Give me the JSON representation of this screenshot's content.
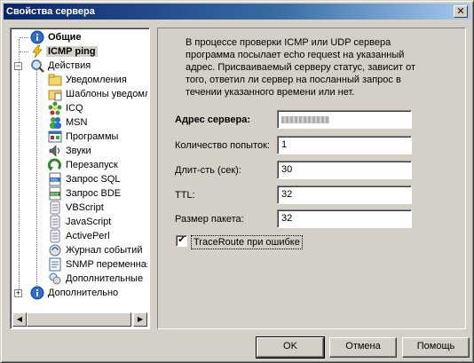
{
  "window": {
    "title": "Свойства сервера",
    "close": "✕"
  },
  "tree": {
    "items": [
      {
        "label": "Общие",
        "icon": "info-icon"
      },
      {
        "label": "ICMP ping",
        "icon": "lightning-icon"
      },
      {
        "label": "Действия",
        "icon": "search-icon"
      },
      {
        "label": "Уведомления",
        "icon": "folder-icon"
      },
      {
        "label": "Шаблоны уведомл",
        "icon": "folder-template-icon"
      },
      {
        "label": "ICQ",
        "icon": "icq-flower-icon"
      },
      {
        "label": "MSN",
        "icon": "msn-people-icon"
      },
      {
        "label": "Программы",
        "icon": "programs-icon"
      },
      {
        "label": "Звуки",
        "icon": "speaker-icon"
      },
      {
        "label": "Перезапуск",
        "icon": "restart-arrow-icon"
      },
      {
        "label": "Запрос SQL",
        "icon": "sql-doc-icon"
      },
      {
        "label": "Запрос BDE",
        "icon": "bde-doc-icon"
      },
      {
        "label": "VBScript",
        "icon": "script-scroll-icon"
      },
      {
        "label": "JavaScript",
        "icon": "script-scroll-icon"
      },
      {
        "label": "ActivePerl",
        "icon": "script-scroll-icon"
      },
      {
        "label": "Журнал событий",
        "icon": "journal-icon"
      },
      {
        "label": "SNMP переменная",
        "icon": "snmp-doc-icon"
      },
      {
        "label": "Дополнительные",
        "icon": "additional-icon"
      },
      {
        "label": "Дополнительно",
        "icon": "info-icon"
      }
    ]
  },
  "panel": {
    "description": "В процессе проверки ICMP или UDP сервера программа посылает echo request на указанный адрес. Присваиваемый серверу статус, зависит от того, ответил ли сервер на посланный запрос в течении указанного времени или нет.",
    "fields": [
      {
        "label": "Адрес сервера:",
        "value": ""
      },
      {
        "label": "Количество попыток:",
        "value": "1"
      },
      {
        "label": "Длит-сть (сек):",
        "value": "30"
      },
      {
        "label": "TTL:",
        "value": "32"
      },
      {
        "label": "Размер пакета:",
        "value": "32"
      }
    ],
    "traceroute": {
      "label": "TraceRoute при ошибке",
      "checked": true,
      "mark": "✔"
    }
  },
  "buttons": {
    "ok": "OK",
    "cancel": "Отмена",
    "help": "Помощь"
  }
}
